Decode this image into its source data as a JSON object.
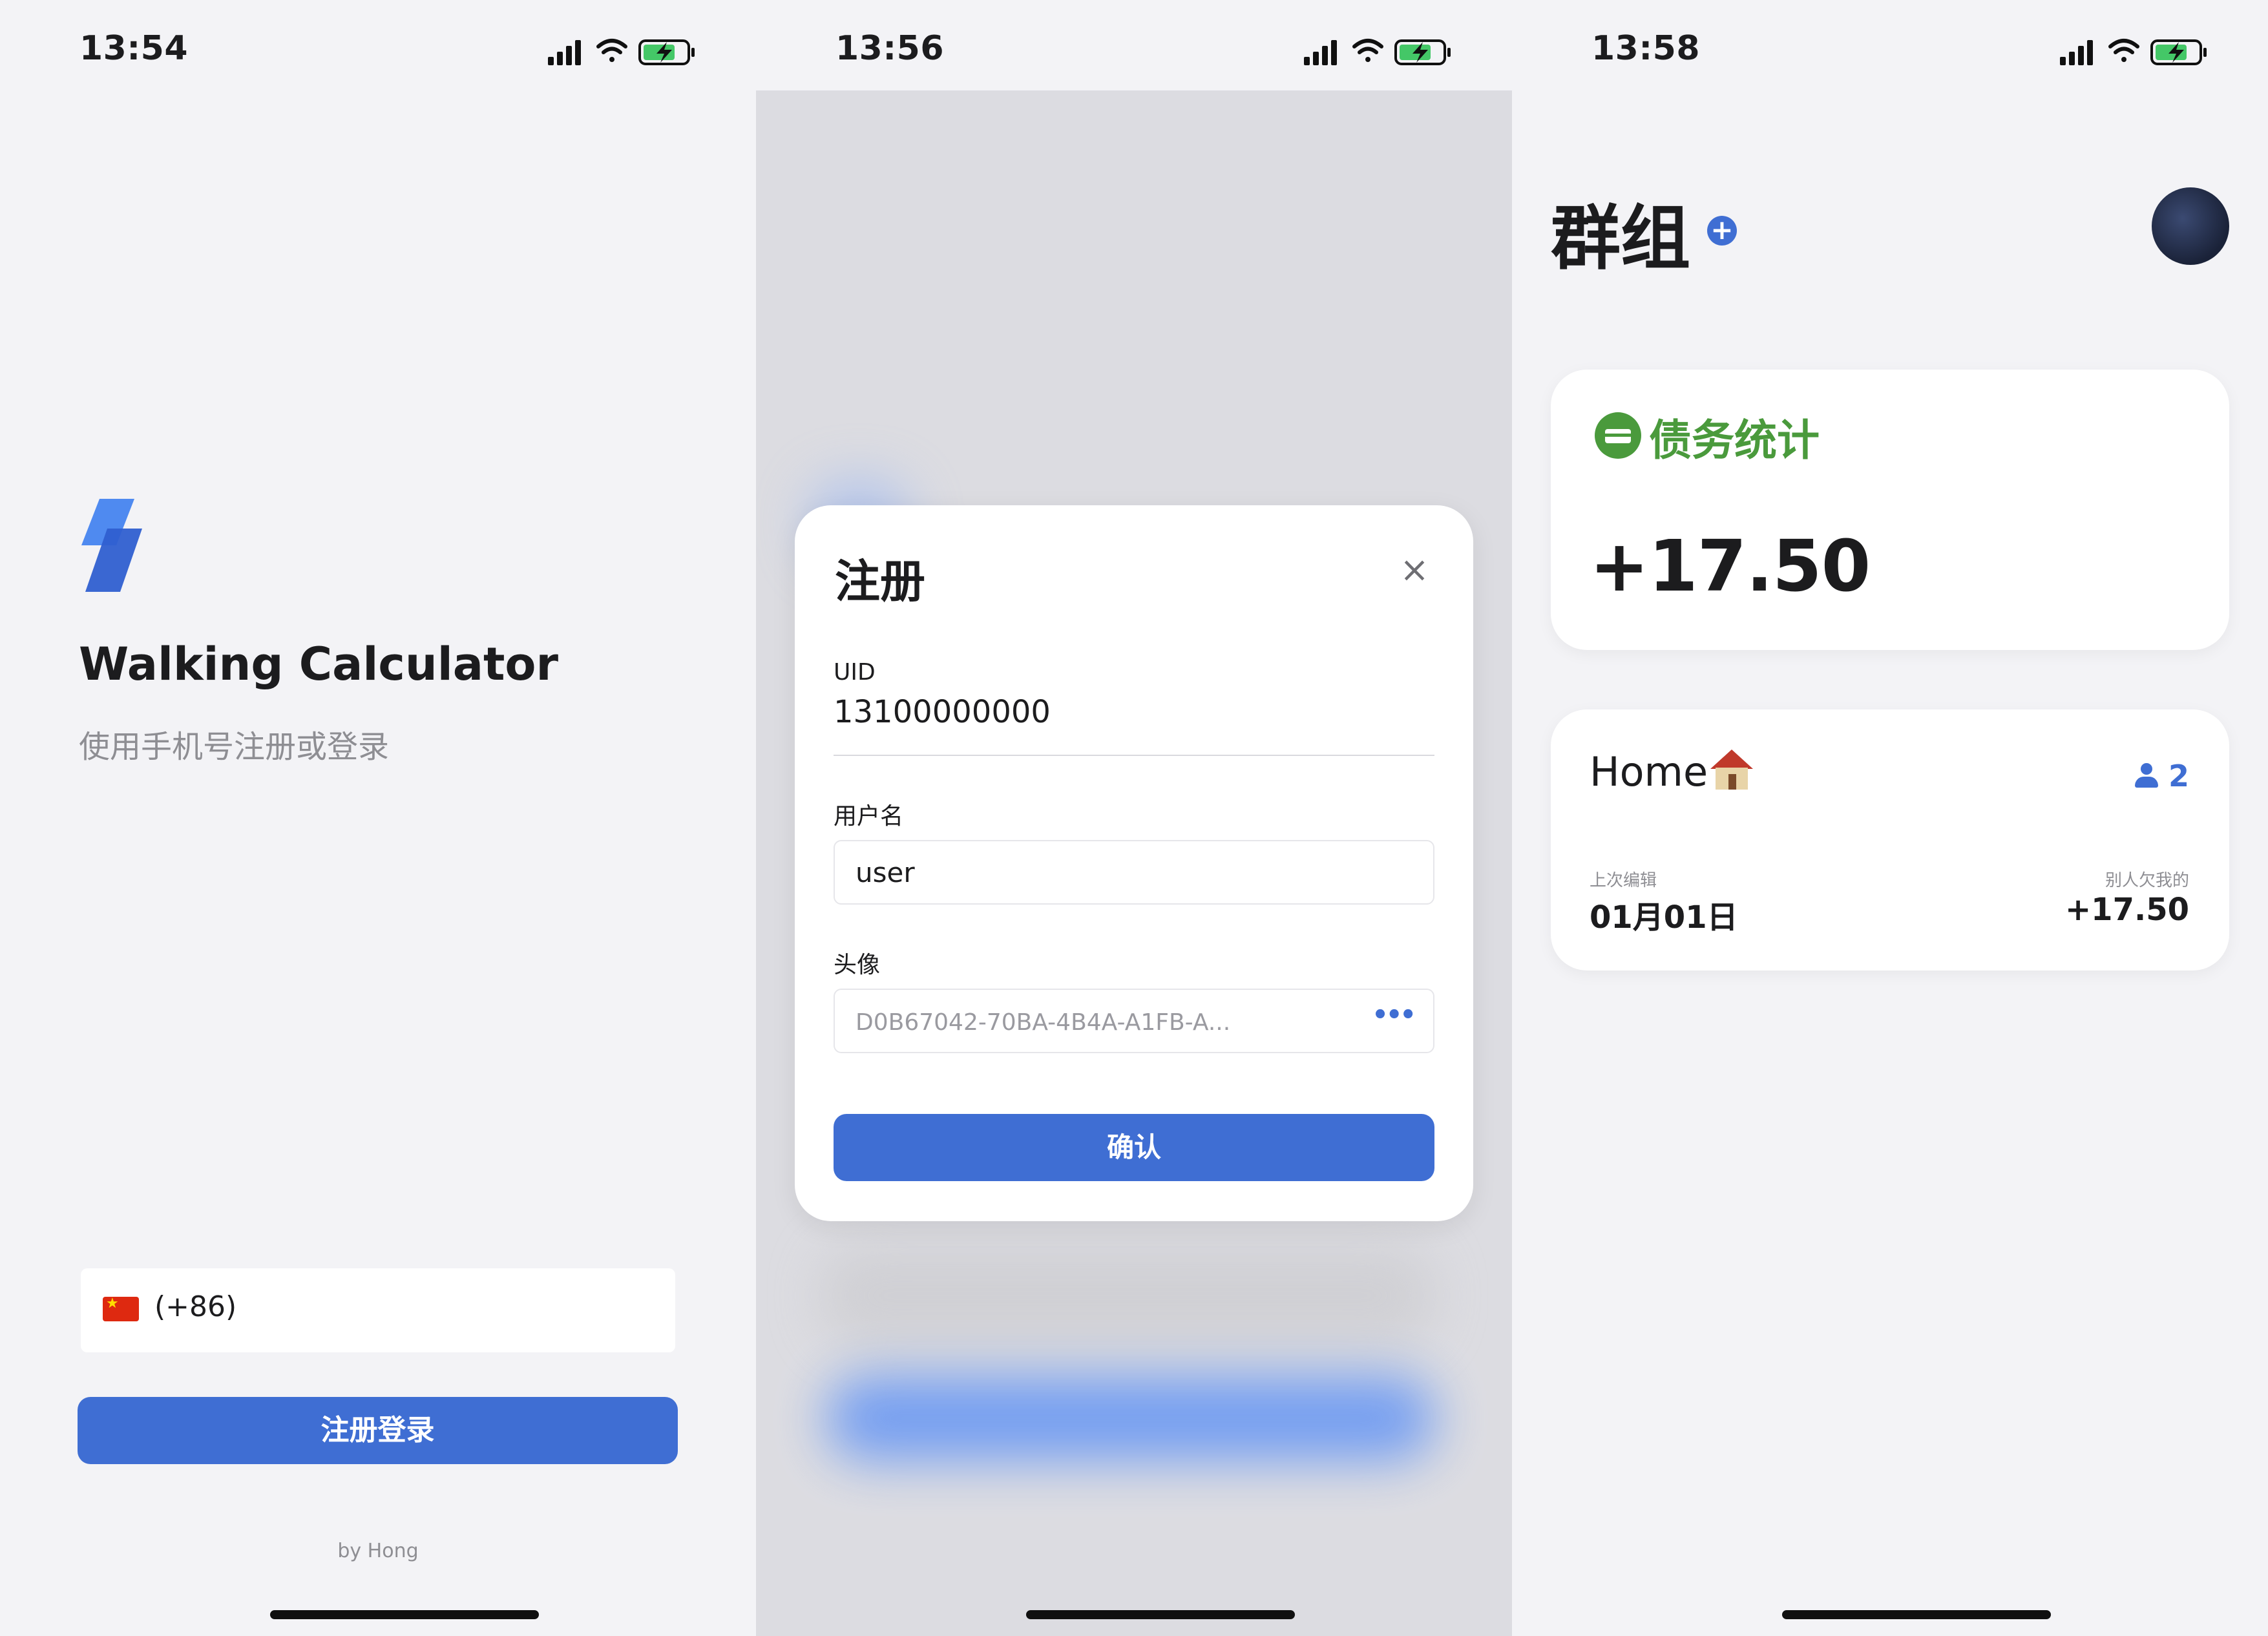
{
  "screens": [
    {
      "status": {
        "time": "13:54"
      },
      "app_title": "Walking Calculator",
      "subtitle": "使用手机号注册或登录",
      "phone": {
        "flag_icon": "china-flag-icon",
        "country_code": "(+86)"
      },
      "login_button": "注册登录",
      "byline": "by Hong"
    },
    {
      "status": {
        "time": "13:56"
      },
      "modal": {
        "title": "注册",
        "close_icon": "close-icon",
        "uid_label": "UID",
        "uid_value": "13100000000",
        "username_label": "用户名",
        "username_value": "user",
        "avatar_label": "头像",
        "avatar_value": "D0B67042-70BA-4B4A-A1FB-A...",
        "more_icon": "ellipsis-icon",
        "confirm_button": "确认"
      }
    },
    {
      "status": {
        "time": "13:58"
      },
      "page_title": "群组",
      "add_icon": "plus-circle-icon",
      "debt_card": {
        "title": "债务统计",
        "amount": "+17.50"
      },
      "group_card": {
        "name": "Home",
        "members": "2",
        "last_edit_label": "上次编辑",
        "last_edit_value": "01月01日",
        "owed_label": "别人欠我的",
        "owed_value": "+17.50"
      }
    }
  ],
  "colors": {
    "accent": "#3f6ed3",
    "green": "#4a9a3c",
    "background": "#f3f3f6"
  }
}
